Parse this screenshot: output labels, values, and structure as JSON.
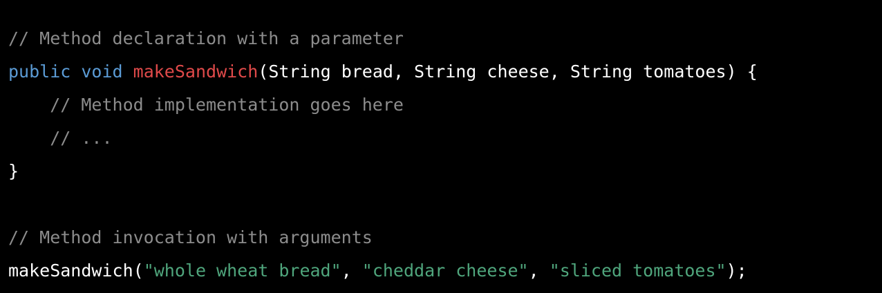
{
  "colors": {
    "background": "#000000",
    "comment": "#8c8c8c",
    "keyword": "#5b9bd5",
    "function_name": "#e04a4a",
    "string": "#4fa57c",
    "text": "#ffffff"
  },
  "code": {
    "line1": {
      "comment": "// Method declaration with a parameter"
    },
    "line2": {
      "kw_public": "public",
      "sp1": " ",
      "kw_void": "void",
      "sp2": " ",
      "fn": "makeSandwich",
      "params": "(String bread, String cheese, String tomatoes) {"
    },
    "line3": {
      "indent": "    ",
      "comment": "// Method implementation goes here"
    },
    "line4": {
      "indent": "    ",
      "comment": "// ..."
    },
    "line5": {
      "text": "}"
    },
    "line6": {
      "text": ""
    },
    "line7": {
      "comment": "// Method invocation with arguments"
    },
    "line8": {
      "fn": "makeSandwich",
      "open": "(",
      "arg1": "\"whole wheat bread\"",
      "sep1": ", ",
      "arg2": "\"cheddar cheese\"",
      "sep2": ", ",
      "arg3": "\"sliced tomatoes\"",
      "close": ");"
    }
  }
}
